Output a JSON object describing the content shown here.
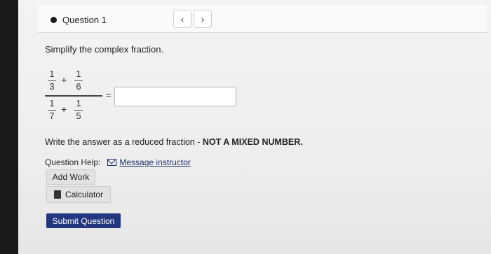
{
  "question_nav": {
    "label": "Question 1",
    "prev_icon": "‹",
    "next_icon": "›"
  },
  "prompt": "Simplify the complex fraction.",
  "fraction": {
    "top": {
      "n1": "1",
      "d1": "3",
      "op": "+",
      "n2": "1",
      "d2": "6"
    },
    "bottom": {
      "n1": "1",
      "d1": "7",
      "op": "+",
      "n2": "1",
      "d2": "5"
    },
    "equals": "="
  },
  "answer": {
    "value": ""
  },
  "instruction": {
    "text": "Write the answer as a reduced fraction - ",
    "bold": "NOT A MIXED NUMBER."
  },
  "help": {
    "label": "Question Help:",
    "message_link": "Message instructor"
  },
  "buttons": {
    "add_work": "Add Work",
    "calculator": "Calculator",
    "submit": "Submit Question"
  },
  "colors": {
    "submit_bg": "#23357d",
    "link": "#1f2f6b"
  }
}
